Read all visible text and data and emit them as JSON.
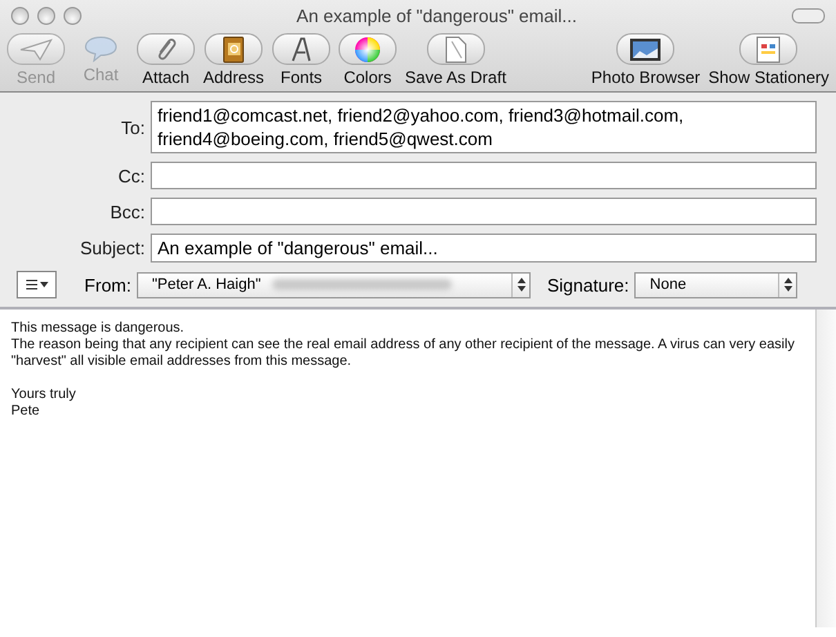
{
  "window": {
    "title": "An example of \"dangerous\" email..."
  },
  "toolbar": [
    {
      "label": "Send",
      "kind": "send",
      "disabled": true
    },
    {
      "label": "Chat",
      "kind": "chat",
      "disabled": true
    },
    {
      "label": "Attach",
      "kind": "attach",
      "disabled": false
    },
    {
      "label": "Address",
      "kind": "address",
      "disabled": false
    },
    {
      "label": "Fonts",
      "kind": "fonts",
      "disabled": false
    },
    {
      "label": "Colors",
      "kind": "colors",
      "disabled": false
    },
    {
      "label": "Save As Draft",
      "kind": "draft",
      "disabled": false
    },
    {
      "label": "Photo Browser",
      "kind": "photo",
      "disabled": false
    },
    {
      "label": "Show Stationery",
      "kind": "stationery",
      "disabled": false
    }
  ],
  "fields": [
    {
      "label": "To:",
      "value": "friend1@comcast.net, friend2@yahoo.com, friend3@hotmail.com, friend4@boeing.com, friend5@qwest.com"
    },
    {
      "label": "Cc:"
    },
    {
      "label": "Bcc:"
    },
    {
      "label": "Subject:",
      "value": "An example of \"dangerous\" email..."
    }
  ],
  "from": {
    "label": "From:",
    "value": "\"Peter A. Haigh\""
  },
  "signature": {
    "label": "Signature:",
    "value": "None"
  },
  "body": [
    {
      "lines": [
        "This message is dangerous.",
        "The reason being that any recipient can see the real email address of any other recipient of the message. A virus can very easily \"harvest\" all visible email addresses from this message."
      ]
    },
    {
      "lines": [
        "Yours truly",
        "Pete"
      ]
    }
  ]
}
